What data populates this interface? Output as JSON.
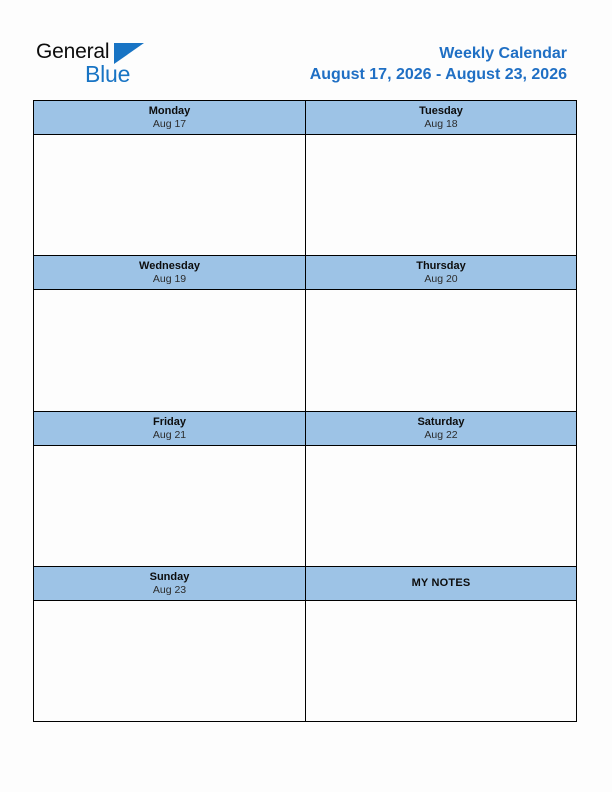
{
  "brand": {
    "name_part1": "General",
    "name_part2": "Blue",
    "triangle_icon": "brand-triangle-icon",
    "accent_color": "#1874c4"
  },
  "header": {
    "title": "Weekly Calendar",
    "date_range": "August 17, 2026 - August 23, 2026",
    "title_color": "#1f6fc4"
  },
  "colors": {
    "header_cell_bg": "#9dc3e6",
    "cell_bg": "#fdfdfd",
    "border": "#000000",
    "page_bg": "#fdfdfd"
  },
  "calendar": {
    "rows": [
      {
        "cells": [
          {
            "type": "day",
            "day": "Monday",
            "date": "Aug 17"
          },
          {
            "type": "day",
            "day": "Tuesday",
            "date": "Aug 18"
          }
        ]
      },
      {
        "cells": [
          {
            "type": "day",
            "day": "Wednesday",
            "date": "Aug 19"
          },
          {
            "type": "day",
            "day": "Thursday",
            "date": "Aug 20"
          }
        ]
      },
      {
        "cells": [
          {
            "type": "day",
            "day": "Friday",
            "date": "Aug 21"
          },
          {
            "type": "day",
            "day": "Saturday",
            "date": "Aug 22"
          }
        ]
      },
      {
        "cells": [
          {
            "type": "day",
            "day": "Sunday",
            "date": "Aug 23"
          },
          {
            "type": "notes",
            "label": "MY NOTES"
          }
        ]
      }
    ]
  }
}
